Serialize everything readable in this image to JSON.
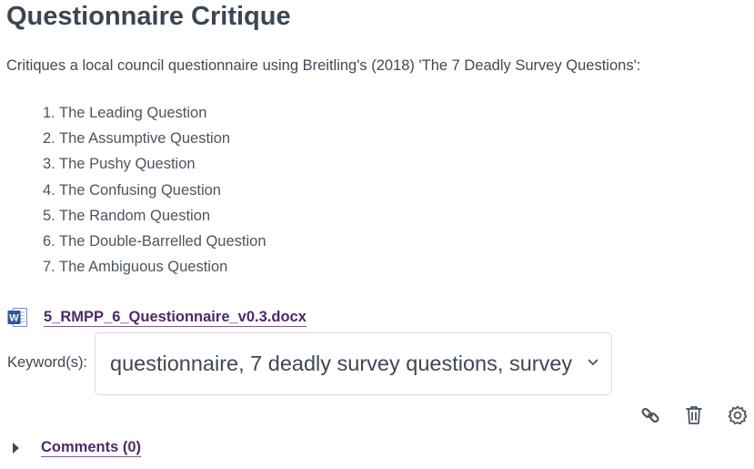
{
  "page": {
    "title": "Questionnaire Critique",
    "description": "Critiques a local council questionnaire using Breitling's (2018) 'The 7 Deadly Survey Questions':"
  },
  "questions": [
    "1. The Leading Question",
    "2. The Assumptive Question",
    "3. The Pushy Question",
    "4. The Confusing Question",
    "5. The Random Question",
    "6. The Double-Barrelled Question",
    "7. The Ambiguous Question"
  ],
  "attachment": {
    "icon": "word-doc-icon",
    "icon_letter": "W",
    "filename": "5_RMPP_6_Questionnaire_v0.3.docx"
  },
  "keywords": {
    "label": "Keyword(s):",
    "value": "questionnaire, 7 deadly survey questions, survey"
  },
  "toolbar": {
    "icons": [
      "link-icon",
      "trash-icon",
      "gear-icon"
    ]
  },
  "comments": {
    "label": "Comments (0)"
  },
  "colors": {
    "text": "#3d4a56",
    "link": "#4d2a6a",
    "word_blue": "#2b5797"
  }
}
